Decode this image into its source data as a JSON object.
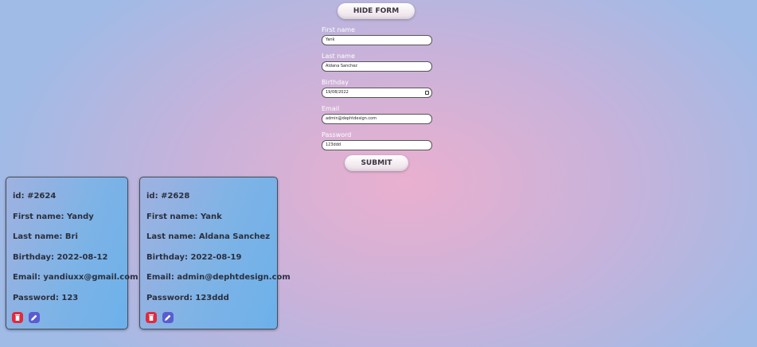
{
  "form": {
    "toggle_label": "HIDE FORM",
    "fields": [
      {
        "label": "First name",
        "value": "Yank",
        "type": "text"
      },
      {
        "label": "Last name",
        "value": "Aldana Sanchez",
        "type": "text"
      },
      {
        "label": "Birthday",
        "value": "19/08/2022",
        "type": "date"
      },
      {
        "label": "Email",
        "value": "admin@dephtdesign.com",
        "type": "email"
      },
      {
        "label": "Password",
        "value": "123ddd",
        "type": "text"
      }
    ],
    "submit_label": "SUBMIT"
  },
  "users": [
    {
      "id": "id: #2624",
      "first_name": "First name: Yandy",
      "last_name": "Last name: Bri",
      "birthday": "Birthday: 2022-08-12",
      "email": "Email: yandiuxx@gmail.com",
      "password": "Password: 123"
    },
    {
      "id": "id: #2628",
      "first_name": "First name: Yank",
      "last_name": "Last name: Aldana Sanchez",
      "birthday": "Birthday: 2022-08-19",
      "email": "Email: admin@dephtdesign.com",
      "password": "Password: 123ddd"
    }
  ],
  "colors": {
    "delete": "#e3293d",
    "edit": "#5a5ccf",
    "card_border": "#474c5a"
  },
  "icons": {
    "delete": "trash-icon",
    "edit": "pencil-icon",
    "date": "calendar-icon"
  }
}
